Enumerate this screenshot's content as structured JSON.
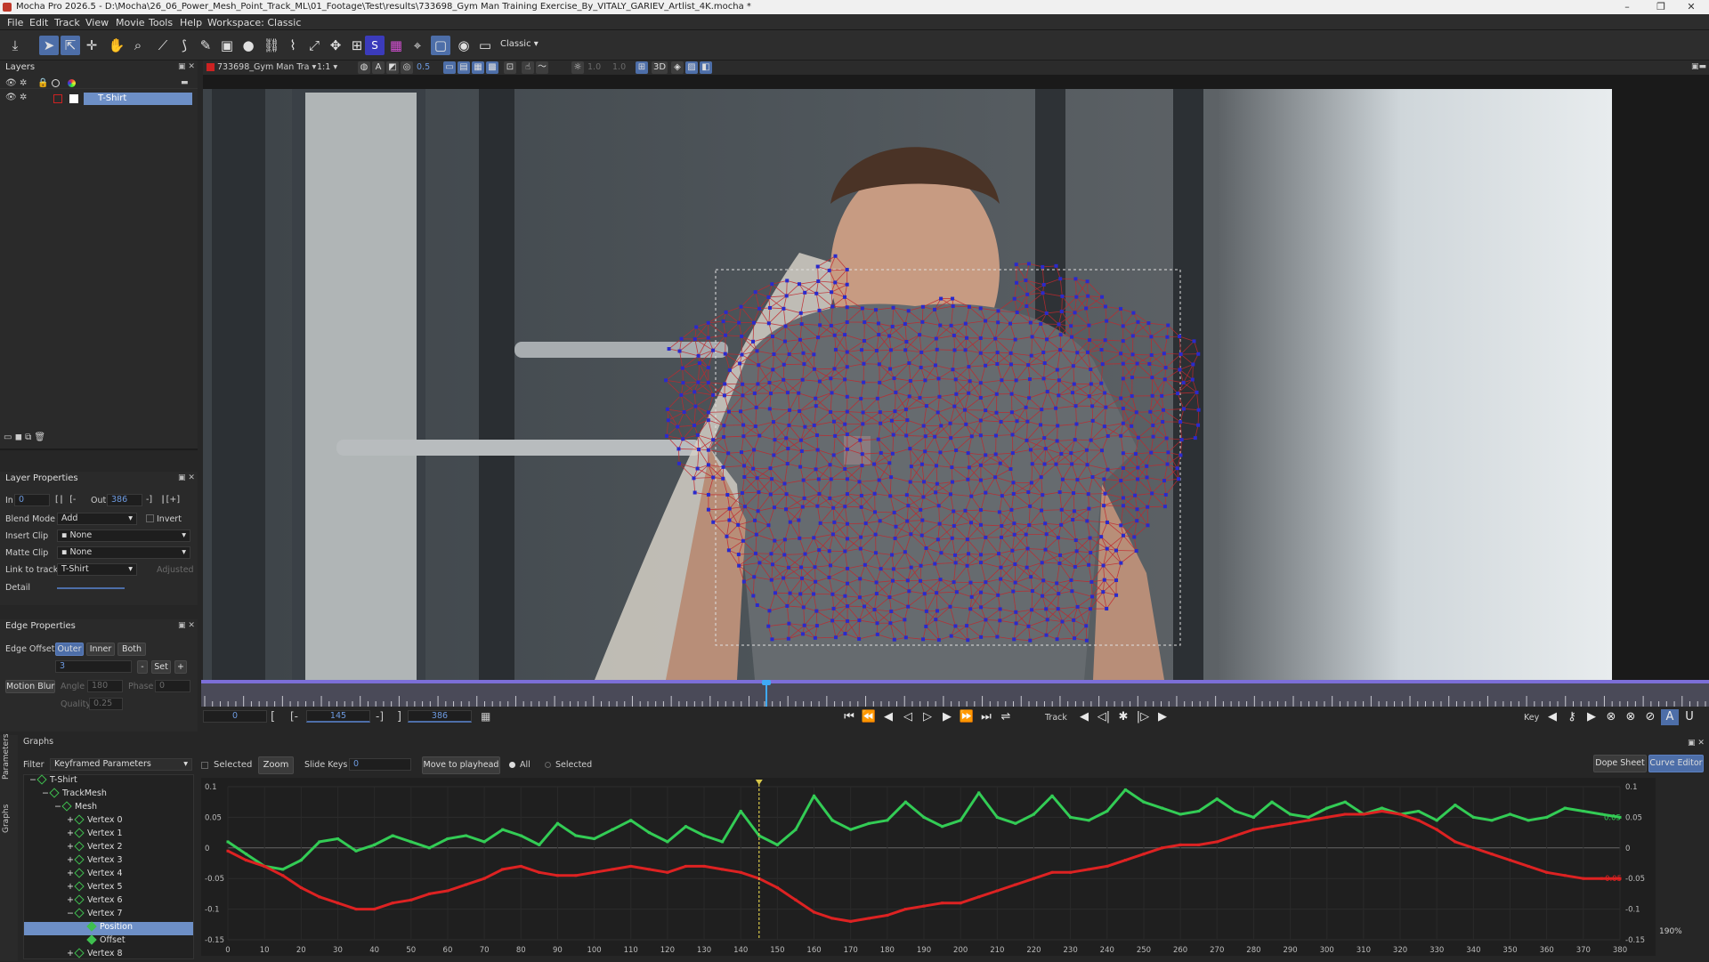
{
  "titlebar": {
    "title": "Mocha Pro 2026.5 - D:\\Mocha\\26_06_Power_Mesh_Point_Track_ML\\01_Footage\\Test\\results\\733698_Gym Man Training Exercise_By_VITALY_GARIEV_Artlist_4K.mocha *",
    "minimize": "–",
    "maximize": "❐",
    "close": "✕"
  },
  "menubar": {
    "items": [
      "File",
      "Edit",
      "Track",
      "View",
      "Movie",
      "Tools",
      "Help"
    ],
    "workspace": "Workspace: Classic"
  },
  "toolbar": {
    "workspace_select": "Classic"
  },
  "viewbar": {
    "clip_name": "733698_Gym Man Tra",
    "zoom": "1:1",
    "opacity": "0.5",
    "value_a": "1.0",
    "value_b": "1.0",
    "mode3d": "3D"
  },
  "layers": {
    "title": "Layers",
    "items": [
      {
        "name": "T-Shirt",
        "color": "#cc2222",
        "selected": true
      }
    ]
  },
  "layer_properties": {
    "title": "Layer Properties",
    "in_label": "In",
    "in_value": "0",
    "out_label": "Out",
    "out_value": "386",
    "blend_mode_label": "Blend Mode",
    "blend_mode_value": "Add",
    "invert_label": "Invert",
    "insert_clip_label": "Insert Clip",
    "insert_clip_value": "None",
    "matte_clip_label": "Matte Clip",
    "matte_clip_value": "None",
    "link_to_track_label": "Link to track",
    "link_to_track_value": "T-Shirt",
    "adjusted_label": "Adjusted",
    "detail_label": "Detail"
  },
  "edge_properties": {
    "title": "Edge Properties",
    "edge_offset_label": "Edge Offset",
    "outer": "Outer",
    "inner": "Inner",
    "both": "Both",
    "offset_value": "3",
    "set_label": "Set",
    "motion_blur_label": "Motion Blur",
    "angle_label": "Angle",
    "angle_value": "180",
    "phase_label": "Phase",
    "phase_value": "0",
    "quality_label": "Quality",
    "quality_value": "0.25"
  },
  "transport": {
    "current_frame": "0",
    "in_point": "145",
    "out_point": "386",
    "track_label": "Track",
    "key_label": "Key"
  },
  "graphs": {
    "title": "Graphs",
    "filter_label": "Filter",
    "filter_value": "Keyframed Parameters",
    "side_tabs": [
      "Parameters",
      "Graphs"
    ],
    "selected_label": "Selected",
    "zoom_label": "Zoom",
    "slide_keys_label": "Slide Keys",
    "slide_keys_value": "0",
    "move_to_playhead": "Move to playhead",
    "all_label": "All",
    "selected_radio": "Selected",
    "dope_sheet": "Dope Sheet",
    "curve_editor": "Curve Editor",
    "zoom_pct": "190%",
    "tree": [
      {
        "label": "T-Shirt",
        "depth": 0,
        "sel": false,
        "fill": false
      },
      {
        "label": "TrackMesh",
        "depth": 1,
        "sel": false,
        "fill": false
      },
      {
        "label": "Mesh",
        "depth": 2,
        "sel": false,
        "fill": false
      },
      {
        "label": "Vertex 0",
        "depth": 3,
        "sel": false,
        "fill": false
      },
      {
        "label": "Vertex 1",
        "depth": 3,
        "sel": false,
        "fill": false
      },
      {
        "label": "Vertex 2",
        "depth": 3,
        "sel": false,
        "fill": false
      },
      {
        "label": "Vertex 3",
        "depth": 3,
        "sel": false,
        "fill": false
      },
      {
        "label": "Vertex 4",
        "depth": 3,
        "sel": false,
        "fill": false
      },
      {
        "label": "Vertex 5",
        "depth": 3,
        "sel": false,
        "fill": false
      },
      {
        "label": "Vertex 6",
        "depth": 3,
        "sel": false,
        "fill": false
      },
      {
        "label": "Vertex 7",
        "depth": 3,
        "sel": false,
        "fill": false
      },
      {
        "label": "Position",
        "depth": 4,
        "sel": true,
        "fill": true
      },
      {
        "label": "Offset",
        "depth": 4,
        "sel": false,
        "fill": true
      },
      {
        "label": "Vertex 8",
        "depth": 3,
        "sel": false,
        "fill": false
      }
    ],
    "y_ticks": [
      "0.1",
      "0.05",
      "0",
      "-0.05",
      "-0.1",
      "-0.15"
    ],
    "y_ticks_right": [
      "0.1",
      "0.05",
      "0",
      "-0.05",
      "-0.1",
      "-0.15"
    ],
    "x_ticks": [
      "0",
      "10",
      "20",
      "30",
      "40",
      "50",
      "60",
      "70",
      "80",
      "90",
      "100",
      "110",
      "120",
      "130",
      "140",
      "150",
      "160",
      "170",
      "180",
      "190",
      "200",
      "210",
      "220",
      "230",
      "240",
      "250",
      "260",
      "270",
      "280",
      "290",
      "300",
      "310",
      "320",
      "330",
      "340",
      "350",
      "360",
      "370",
      "380"
    ],
    "green_label": "0.05",
    "red_label": "-0.05",
    "playhead_frame": 145,
    "green_color": "#33cc55",
    "red_color": "#dd2222"
  },
  "chart_data": {
    "type": "line",
    "xlim": [
      0,
      380
    ],
    "ylim": [
      -0.15,
      0.1
    ],
    "series": [
      {
        "color": "#33cc55",
        "x": [
          0,
          5,
          10,
          15,
          20,
          25,
          30,
          35,
          40,
          45,
          50,
          55,
          60,
          65,
          70,
          75,
          80,
          85,
          90,
          95,
          100,
          105,
          110,
          115,
          120,
          125,
          130,
          135,
          140,
          145,
          150,
          155,
          160,
          165,
          170,
          175,
          180,
          185,
          190,
          195,
          200,
          205,
          210,
          215,
          220,
          225,
          230,
          235,
          240,
          245,
          250,
          255,
          260,
          265,
          270,
          275,
          280,
          285,
          290,
          295,
          300,
          305,
          310,
          315,
          320,
          325,
          330,
          335,
          340,
          345,
          350,
          355,
          360,
          365,
          370,
          375,
          380
        ],
        "y": [
          0.01,
          -0.01,
          -0.03,
          -0.035,
          -0.02,
          0.01,
          0.015,
          -0.005,
          0.005,
          0.02,
          0.01,
          0.0,
          0.015,
          0.02,
          0.01,
          0.03,
          0.02,
          0.005,
          0.04,
          0.02,
          0.015,
          0.03,
          0.045,
          0.025,
          0.01,
          0.035,
          0.02,
          0.01,
          0.06,
          0.02,
          0.005,
          0.03,
          0.085,
          0.045,
          0.03,
          0.04,
          0.045,
          0.075,
          0.05,
          0.035,
          0.045,
          0.09,
          0.05,
          0.04,
          0.055,
          0.085,
          0.05,
          0.045,
          0.06,
          0.095,
          0.075,
          0.065,
          0.055,
          0.06,
          0.08,
          0.06,
          0.05,
          0.075,
          0.055,
          0.05,
          0.065,
          0.075,
          0.055,
          0.065,
          0.055,
          0.06,
          0.045,
          0.07,
          0.05,
          0.045,
          0.055,
          0.045,
          0.05,
          0.065,
          0.06,
          0.055,
          0.05
        ]
      },
      {
        "color": "#dd2222",
        "x": [
          0,
          5,
          10,
          15,
          20,
          25,
          30,
          35,
          40,
          45,
          50,
          55,
          60,
          65,
          70,
          75,
          80,
          85,
          90,
          95,
          100,
          105,
          110,
          115,
          120,
          125,
          130,
          135,
          140,
          145,
          150,
          155,
          160,
          165,
          170,
          175,
          180,
          185,
          190,
          195,
          200,
          205,
          210,
          215,
          220,
          225,
          230,
          235,
          240,
          245,
          250,
          255,
          260,
          265,
          270,
          275,
          280,
          285,
          290,
          295,
          300,
          305,
          310,
          315,
          320,
          325,
          330,
          335,
          340,
          345,
          350,
          355,
          360,
          365,
          370,
          375,
          380
        ],
        "y": [
          -0.005,
          -0.02,
          -0.03,
          -0.045,
          -0.065,
          -0.08,
          -0.09,
          -0.1,
          -0.1,
          -0.09,
          -0.085,
          -0.075,
          -0.07,
          -0.06,
          -0.05,
          -0.035,
          -0.03,
          -0.04,
          -0.045,
          -0.045,
          -0.04,
          -0.035,
          -0.03,
          -0.035,
          -0.04,
          -0.03,
          -0.03,
          -0.035,
          -0.04,
          -0.05,
          -0.065,
          -0.085,
          -0.105,
          -0.115,
          -0.12,
          -0.115,
          -0.11,
          -0.1,
          -0.095,
          -0.09,
          -0.09,
          -0.08,
          -0.07,
          -0.06,
          -0.05,
          -0.04,
          -0.04,
          -0.035,
          -0.03,
          -0.02,
          -0.01,
          0.0,
          0.005,
          0.005,
          0.01,
          0.02,
          0.03,
          0.035,
          0.04,
          0.045,
          0.05,
          0.055,
          0.055,
          0.06,
          0.055,
          0.045,
          0.03,
          0.01,
          0.0,
          -0.01,
          -0.02,
          -0.03,
          -0.04,
          -0.045,
          -0.05,
          -0.05,
          -0.05
        ]
      }
    ]
  }
}
